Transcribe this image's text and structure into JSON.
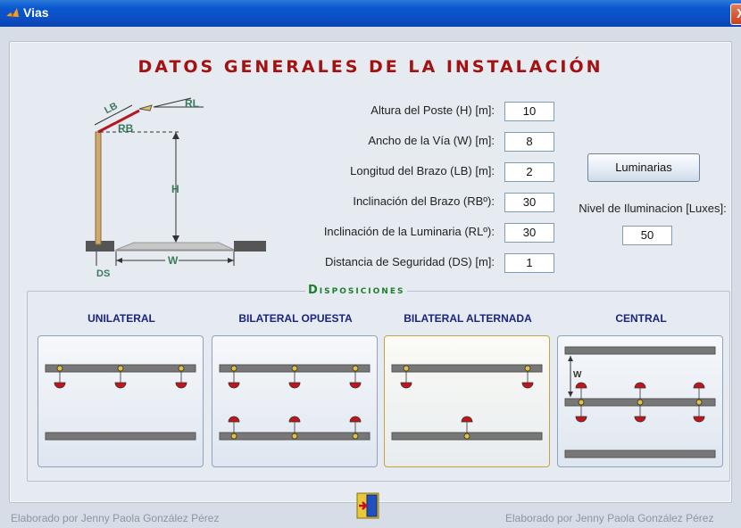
{
  "window": {
    "title": "Vias",
    "close_glyph": "X"
  },
  "heading": "DATOS GENERALES DE LA INSTALACIÓN",
  "diagram": {
    "labels": {
      "rl": "RL",
      "lb": "LB",
      "rb": "RB",
      "h": "H",
      "w": "W",
      "ds": "DS"
    }
  },
  "fields": [
    {
      "label": "Altura del Poste (H) [m]:",
      "value": "10"
    },
    {
      "label": "Ancho de la Vía (W) [m]:",
      "value": "8"
    },
    {
      "label": "Longitud del Brazo (LB) [m]:",
      "value": "2"
    },
    {
      "label": "Inclinación del Brazo (RBº):",
      "value": "30"
    },
    {
      "label": "Inclinación de la Luminaria (RLº):",
      "value": "30"
    },
    {
      "label": "Distancia de Seguridad (DS) [m]:",
      "value": "1"
    }
  ],
  "luminarias_button": "Luminarias",
  "nivel": {
    "label": "Nivel de Iluminacion [Luxes]:",
    "value": "50"
  },
  "disposiciones": {
    "title": "Disposiciones",
    "options": [
      "UNILATERAL",
      "BILATERAL OPUESTA",
      "BILATERAL ALTERNADA",
      "CENTRAL"
    ],
    "central_w_label": "W"
  },
  "footer": {
    "left": "Elaborado por Jenny Paola González Pérez",
    "right": "Elaborado por Jenny Paola González Pérez"
  },
  "colors": {
    "heading": "#a31111",
    "disposiciones": "#1c7f2c",
    "option_titles": "#1a2480",
    "lamp": "#c0151b"
  }
}
